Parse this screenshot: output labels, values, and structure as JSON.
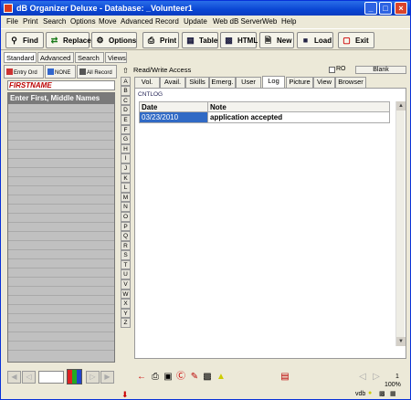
{
  "window": {
    "title": "dB Organizer Deluxe - Database: _Volunteer1",
    "minimize": "_",
    "maximize": "□",
    "close": "×"
  },
  "menu": [
    "File",
    "Print",
    "Search",
    "Options",
    "Move",
    "Advanced",
    "Record",
    "Update",
    "Web dB Server",
    "Web",
    "Help"
  ],
  "toolbar": [
    {
      "label": "Find",
      "icon": "magnifier-icon"
    },
    {
      "label": "Replace",
      "icon": "replace-icon"
    },
    {
      "label": "Options",
      "icon": "options-icon"
    },
    {
      "label": "Print",
      "icon": "printer-icon"
    },
    {
      "label": "Table",
      "icon": "table-icon"
    },
    {
      "label": "HTML",
      "icon": "html-icon"
    },
    {
      "label": "New",
      "icon": "new-document-icon"
    },
    {
      "label": "Load",
      "icon": "load-icon"
    },
    {
      "label": "Exit",
      "icon": "exit-icon"
    }
  ],
  "view_tabs": [
    "Standard",
    "Advanced",
    "Search",
    "Views"
  ],
  "left_panel": {
    "order_tabs": [
      "Entry Ord",
      "NONE",
      "All Record"
    ],
    "field_header": "FIRSTNAME",
    "first_row": "Enter First, Middle Names",
    "record_box_value": ""
  },
  "alphabet": [
    "A",
    "B",
    "C",
    "D",
    "E",
    "F",
    "G",
    "H",
    "I",
    "J",
    "K",
    "L",
    "M",
    "N",
    "O",
    "P",
    "Q",
    "R",
    "S",
    "T",
    "U",
    "V",
    "W",
    "X",
    "Y",
    "Z"
  ],
  "access": {
    "label": "Read/Write Access",
    "ro_label": "RO",
    "ro_checked": false,
    "blank_button": "Blank"
  },
  "record_tabs": [
    "Vol.",
    "Avail.",
    "Skills",
    "Emerg.",
    "User",
    "Log",
    "Picture",
    "View",
    "Browser"
  ],
  "active_tab": "Log",
  "log": {
    "caption": "CNTLOG",
    "columns": [
      "Date",
      "Note"
    ],
    "rows": [
      {
        "date": "03/23/2010",
        "note": "application accepted"
      }
    ]
  },
  "status": {
    "left": "",
    "vdb_label": "vdb",
    "zoom": "100%",
    "record_no": "1"
  },
  "colors": {
    "titlebar": "#0a46d4",
    "selection": "#316ac5",
    "field_header_text": "#bb0000",
    "list_bg": "#c0c0c0"
  }
}
